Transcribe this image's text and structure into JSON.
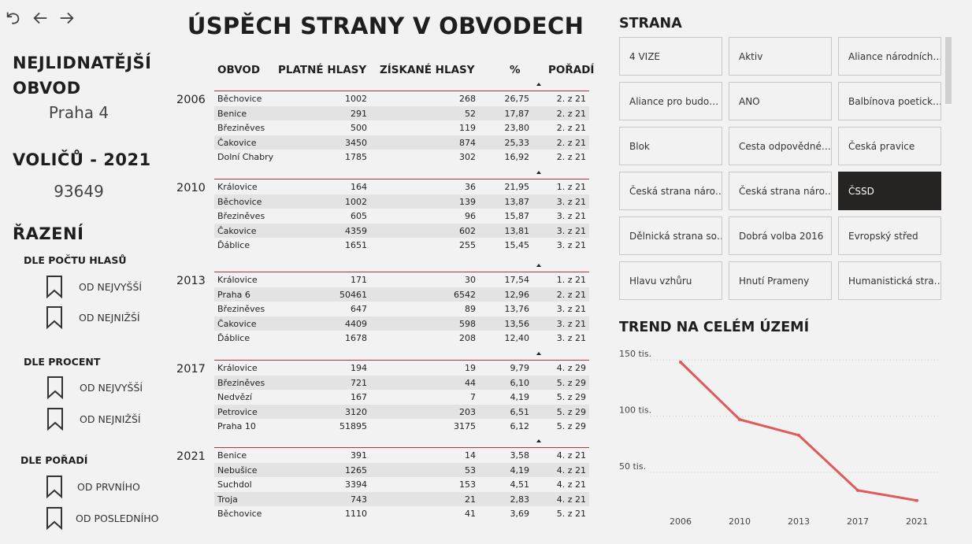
{
  "nav": {
    "undo": "undo-icon",
    "back": "arrow-left-icon",
    "forward": "arrow-right-icon"
  },
  "left": {
    "most_populous_label_1": "NEJLIDNATĚJŠÍ",
    "most_populous_label_2": "OBVOD",
    "most_populous_value": "Praha 4",
    "voters_label": "VOLIČŮ - 2021",
    "voters_value": "93649",
    "sort_title": "ŘAZENÍ",
    "groups": [
      {
        "title": "DLE POČTU HLASŮ",
        "opt1": "OD NEJVYŠŠÍ",
        "opt2": "OD NEJNIŽŠÍ"
      },
      {
        "title": "DLE PROCENT",
        "opt1": "OD NEJVYŠŠÍ",
        "opt2": "OD NEJNIŽŠÍ"
      },
      {
        "title": "DLE POŘADÍ",
        "opt1": "OD PRVNÍHO",
        "opt2": "OD POSLEDNÍHO"
      }
    ]
  },
  "title": "ÚSPĚCH STRANY V OBVODECH",
  "table": {
    "headers": {
      "obvod": "OBVOD",
      "platne": "PLATNÉ HLASY",
      "ziskane": "ZÍSKANÉ HLASY",
      "pct": "%",
      "poradi": "POŘADÍ"
    },
    "years": [
      {
        "year": "2006",
        "rows": [
          [
            "Běchovice",
            "1002",
            "268",
            "26,75",
            "2. z 21"
          ],
          [
            "Benice",
            "291",
            "52",
            "17,87",
            "2. z 21"
          ],
          [
            "Březiněves",
            "500",
            "119",
            "23,80",
            "2. z 21"
          ],
          [
            "Čakovice",
            "3450",
            "874",
            "25,33",
            "2. z 21"
          ],
          [
            "Dolní Chabry",
            "1785",
            "302",
            "16,92",
            "2. z 21"
          ]
        ]
      },
      {
        "year": "2010",
        "rows": [
          [
            "Královice",
            "164",
            "36",
            "21,95",
            "1. z 21"
          ],
          [
            "Běchovice",
            "1002",
            "139",
            "13,87",
            "3. z 21"
          ],
          [
            "Březiněves",
            "605",
            "96",
            "15,87",
            "3. z 21"
          ],
          [
            "Čakovice",
            "4359",
            "602",
            "13,81",
            "3. z 21"
          ],
          [
            "Ďáblice",
            "1651",
            "255",
            "15,45",
            "3. z 21"
          ]
        ]
      },
      {
        "year": "2013",
        "rows": [
          [
            "Královice",
            "171",
            "30",
            "17,54",
            "1. z 21"
          ],
          [
            "Praha 6",
            "50461",
            "6542",
            "12,96",
            "2. z 21"
          ],
          [
            "Březiněves",
            "647",
            "89",
            "13,76",
            "3. z 21"
          ],
          [
            "Čakovice",
            "4409",
            "598",
            "13,56",
            "3. z 21"
          ],
          [
            "Ďáblice",
            "1678",
            "208",
            "12,40",
            "3. z 21"
          ]
        ]
      },
      {
        "year": "2017",
        "rows": [
          [
            "Královice",
            "194",
            "19",
            "9,79",
            "4. z 29"
          ],
          [
            "Březiněves",
            "721",
            "44",
            "6,10",
            "5. z 29"
          ],
          [
            "Nedvězí",
            "167",
            "7",
            "4,19",
            "5. z 29"
          ],
          [
            "Petrovice",
            "3120",
            "203",
            "6,51",
            "5. z 29"
          ],
          [
            "Praha 10",
            "51895",
            "3175",
            "6,12",
            "5. z 29"
          ]
        ]
      },
      {
        "year": "2021",
        "rows": [
          [
            "Benice",
            "391",
            "14",
            "3,58",
            "4. z 21"
          ],
          [
            "Nebušice",
            "1265",
            "53",
            "4,19",
            "4. z 21"
          ],
          [
            "Suchdol",
            "3394",
            "153",
            "4,51",
            "4. z 21"
          ],
          [
            "Troja",
            "743",
            "21",
            "2,83",
            "4. z 21"
          ],
          [
            "Běchovice",
            "1110",
            "41",
            "3,69",
            "5. z 21"
          ]
        ]
      }
    ]
  },
  "strana": {
    "title": "STRANA",
    "items": [
      "4 VIZE",
      "Aktiv",
      "Aliance národních…",
      "Aliance pro budo…",
      "ANO",
      "Balbínova poetick…",
      "Blok",
      "Cesta odpovědné…",
      "Česká pravice",
      "Česká strana náro…",
      "Česká strana náro…",
      "ČSSD",
      "Dělnická strana so…",
      "Dobrá volba 2016",
      "Evropský střed",
      "Hlavu vzhůru",
      "Hnutí Prameny",
      "Humanistická stra…"
    ],
    "selected": "ČSSD"
  },
  "trend": {
    "title": "TREND NA CELÉM ÚZEMÍ",
    "line_color": "#e05a5a"
  },
  "chart_data": {
    "type": "line",
    "x": [
      "2006",
      "2010",
      "2013",
      "2017",
      "2021"
    ],
    "values": [
      148000,
      97000,
      83000,
      34000,
      25000
    ],
    "ylim": [
      15000,
      155000
    ],
    "yticks": [
      50000,
      100000,
      150000
    ],
    "ytick_labels": [
      "50 tis.",
      "100 tis.",
      "150 tis."
    ],
    "grid": true
  }
}
